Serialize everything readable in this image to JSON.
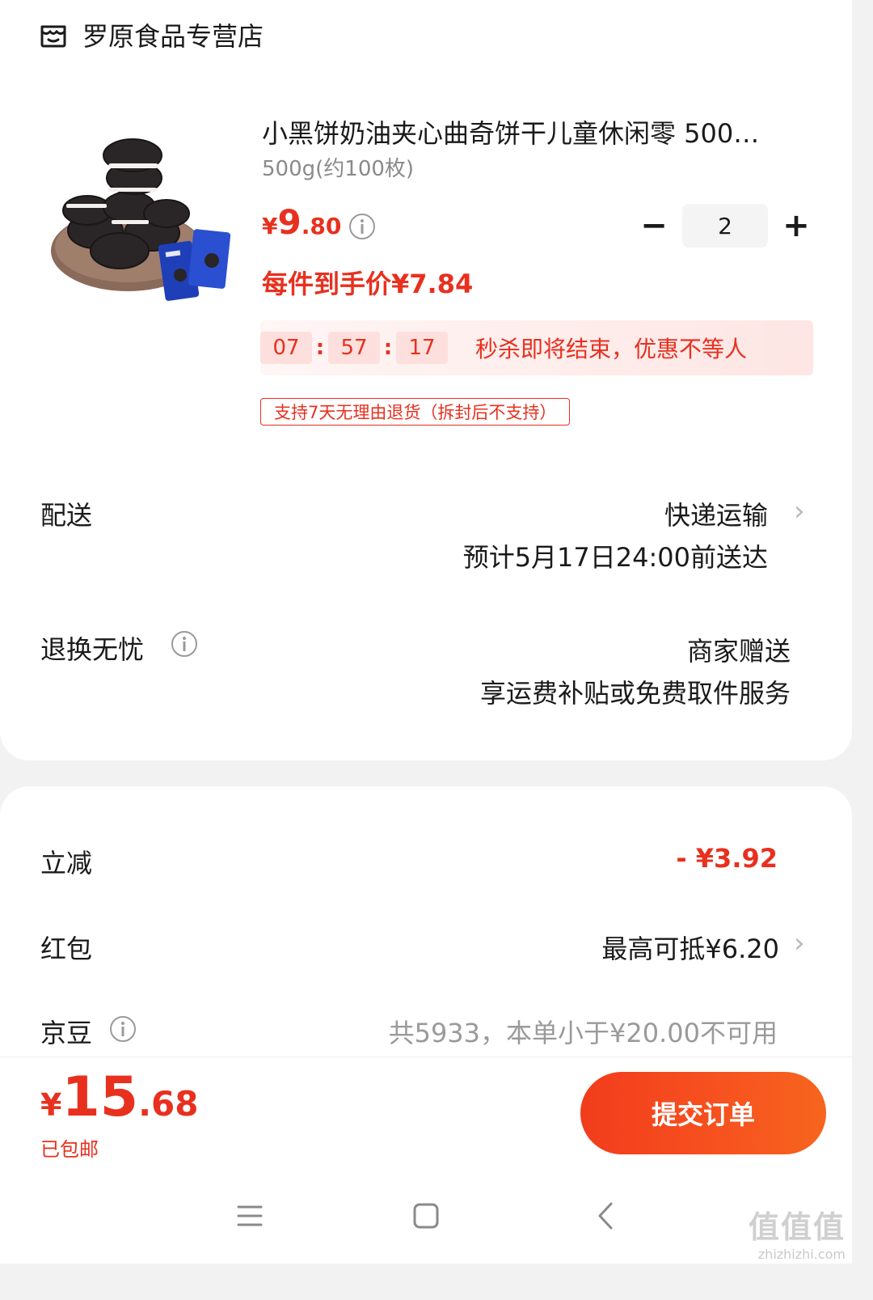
{
  "store": {
    "name": "罗原食品专营店",
    "icon": "store-icon"
  },
  "product": {
    "title": "小黑饼奶油夹心曲奇饼干儿童休闲零 500…",
    "spec": "500g(约100枚)",
    "price_symbol": "¥",
    "price_int": "9",
    "price_dec": ".80",
    "unit_price": "每件到手价¥7.84",
    "quantity": "2",
    "minus_label": "−",
    "plus_label": "+"
  },
  "flash_sale": {
    "hours": "07",
    "minutes": "57",
    "seconds": "17",
    "colon": ":",
    "text": "秒杀即将结束，优惠不等人"
  },
  "return_tag": "支持7天无理由退货（拆封后不支持）",
  "delivery": {
    "label": "配送",
    "method": "快递运输",
    "eta": "预计5月17日24:00前送达"
  },
  "worry_free": {
    "label": "退换无忧",
    "line1": "商家赠送",
    "line2": "享运费补贴或免费取件服务"
  },
  "discount": {
    "label": "立减",
    "value": "- ¥3.92"
  },
  "red_packet": {
    "label": "红包",
    "value": "最高可抵¥6.20"
  },
  "jingdou": {
    "label": "京豆",
    "value": "共5933，本单小于¥20.00不可用"
  },
  "footer": {
    "total_symbol": "¥",
    "total_int": "15",
    "total_dec": ".68",
    "shipping": "已包邮",
    "submit": "提交订单"
  },
  "watermark": {
    "big": "值值值",
    "small": "zhizhizhi.com"
  },
  "colors": {
    "accent": "#e8301f",
    "button": "#f23c1c"
  }
}
